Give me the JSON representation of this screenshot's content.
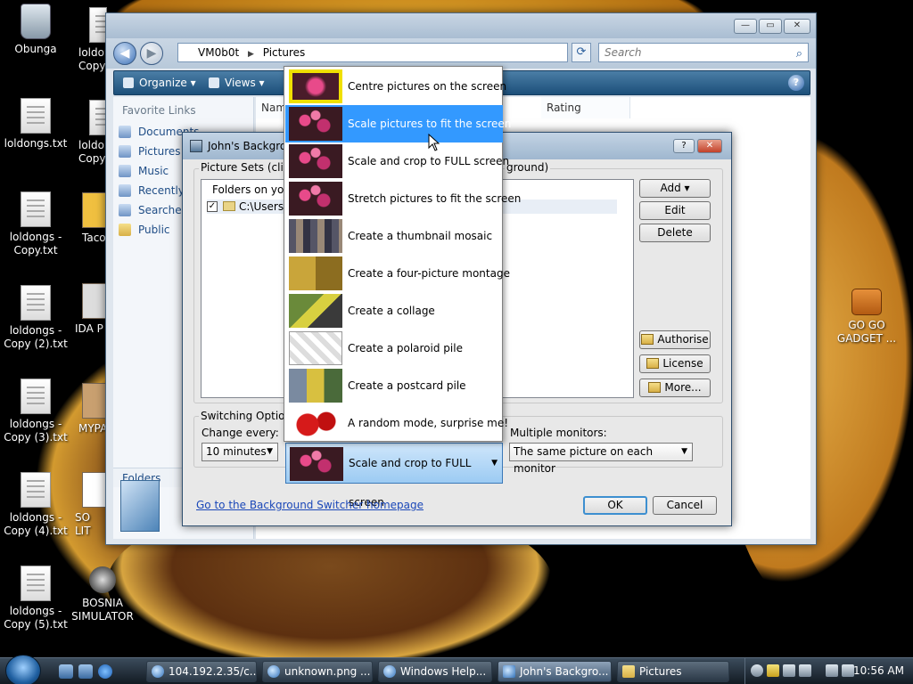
{
  "desktop": {
    "icons": [
      {
        "label": "Obunga"
      },
      {
        "label": "loldongs.txt"
      },
      {
        "label": "loldongs - Copy.txt"
      },
      {
        "label": "loldongs - Copy (2).txt"
      },
      {
        "label": "loldongs - Copy (3).txt"
      },
      {
        "label": "loldongs - Copy (4).txt"
      },
      {
        "label": "loldongs - Copy (5).txt"
      },
      {
        "label": "loldo Copy"
      },
      {
        "label": "loldo Copy"
      },
      {
        "label": "Taco"
      },
      {
        "label": "IDA P"
      },
      {
        "label": "MYPA"
      },
      {
        "label": "SO LIT"
      },
      {
        "label": "BOSNIA SIMULATOR"
      },
      {
        "label": "GO GO GADGET ..."
      }
    ]
  },
  "explorer": {
    "address": {
      "parts": [
        "VM0b0t",
        "Pictures"
      ]
    },
    "search_placeholder": "Search",
    "toolbar": {
      "organize": "Organize",
      "views": "Views"
    },
    "favorites_title": "Favorite Links",
    "favorites": [
      "Documents",
      "Pictures",
      "Music",
      "Recently Changed",
      "Searches",
      "Public"
    ],
    "folders_label": "Folders",
    "columns": [
      "Name",
      "Rating"
    ],
    "help": "?"
  },
  "dialog": {
    "title": "John's Background Switcher",
    "picture_sets_label": "Picture Sets (click 'Add' to choose the pictures for your background)",
    "picture_sets_visible_left": "Picture Sets (click 'A",
    "picture_sets_visible_right": "ground)",
    "folders_header": "Folders on your",
    "set_path": "C:\\Users\\V",
    "set_checked": "✓",
    "buttons": {
      "add": "Add",
      "edit": "Edit",
      "delete": "Delete",
      "authorise": "Authorise",
      "license": "License",
      "more": "More...",
      "ok": "OK",
      "cancel": "Cancel"
    },
    "switching_label": "Switching Options",
    "change_every_label": "Change every:",
    "change_every_value": "10 minutes",
    "mode_value": "Scale and crop to FULL screen",
    "multi_monitor_label": "Multiple monitors:",
    "multi_monitor_value": "The same picture on each monitor",
    "homepage_link": "Go to the Background Switcher homepage"
  },
  "dropdown": {
    "selected_index": 1,
    "items": [
      {
        "label": "Centre pictures on the screen",
        "thumb": "centre"
      },
      {
        "label": "Scale pictures to fit the screen",
        "thumb": "flower"
      },
      {
        "label": "Scale and crop to FULL screen",
        "thumb": "flower"
      },
      {
        "label": "Stretch pictures to fit the screen",
        "thumb": "flower"
      },
      {
        "label": "Create a thumbnail mosaic",
        "thumb": "mosaic"
      },
      {
        "label": "Create a four-picture montage",
        "thumb": "montage"
      },
      {
        "label": "Create a collage",
        "thumb": "collage"
      },
      {
        "label": "Create a polaroid pile",
        "thumb": "polaroid"
      },
      {
        "label": "Create a postcard pile",
        "thumb": "postcard"
      },
      {
        "label": "A random mode, surprise me!",
        "thumb": "dice"
      }
    ]
  },
  "taskbar": {
    "tasks": [
      {
        "label": "104.192.2.35/c..."
      },
      {
        "label": "unknown.png ..."
      },
      {
        "label": "Windows Help..."
      },
      {
        "label": "John's Backgro..."
      },
      {
        "label": "Pictures"
      }
    ],
    "clock": "10:56 AM"
  }
}
